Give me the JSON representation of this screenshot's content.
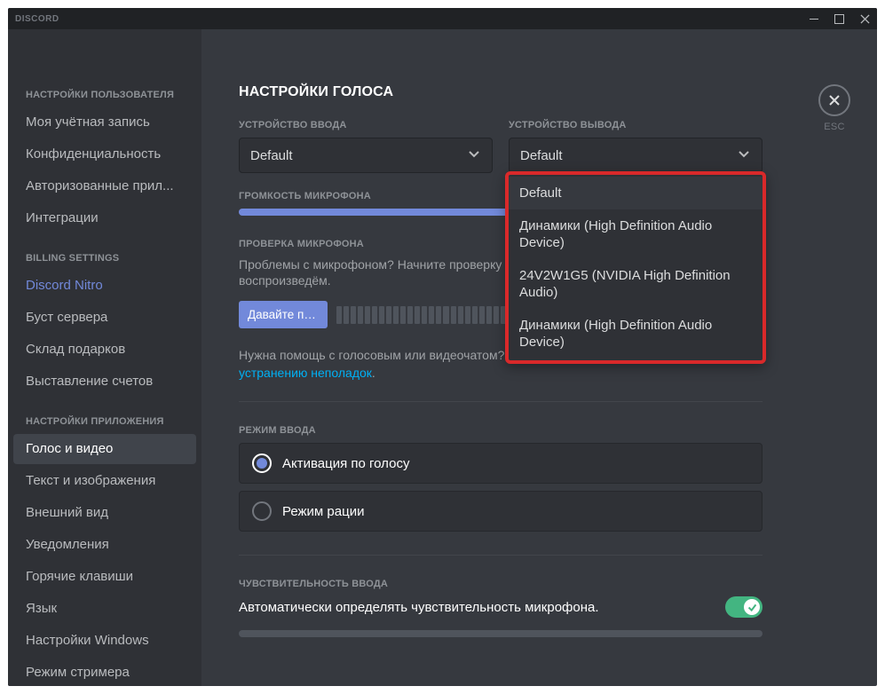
{
  "titlebar": {
    "title": "DISCORD"
  },
  "close": {
    "label": "ESC"
  },
  "sidebar": {
    "section1_header": "НАСТРОЙКИ ПОЛЬЗОВАТЕЛЯ",
    "section1": [
      "Моя учётная запись",
      "Конфиденциальность",
      "Авторизованные прил...",
      "Интеграции"
    ],
    "section2_header": "BILLING SETTINGS",
    "section2": [
      "Discord Nitro",
      "Буст сервера",
      "Склад подарков",
      "Выставление счетов"
    ],
    "section3_header": "НАСТРОЙКИ ПРИЛОЖЕНИЯ",
    "section3": [
      "Голос и видео",
      "Текст и изображения",
      "Внешний вид",
      "Уведомления",
      "Горячие клавиши",
      "Язык",
      "Настройки Windows",
      "Режим стримера"
    ]
  },
  "page": {
    "title": "НАСТРОЙКИ ГОЛОСА",
    "input_device_label": "УСТРОЙСТВО ВВОДА",
    "output_device_label": "УСТРОЙСТВО ВЫВОДА",
    "input_device_value": "Default",
    "output_device_value": "Default",
    "output_options": [
      "Default",
      "Динамики (High Definition Audio Device)",
      "24V2W1G5 (NVIDIA High Definition Audio)",
      "Динамики (High Definition Audio Device)"
    ],
    "mic_volume_label": "ГРОМКОСТЬ МИКРОФОНА",
    "mic_volume_percent": 98,
    "mic_test_label": "ПРОВЕРКА МИКРОФОНА",
    "mic_test_desc": "Проблемы с микрофоном? Начните проверку и скажите что-нибудь забавное — мы воспроизведём.",
    "mic_test_btn": "Давайте пр...",
    "help_pre": "Нужна помощь с голосовым или видеочатом? Ознакомьтесь с нашим ",
    "help_link": "руководством по устранению неполадок",
    "help_post": ".",
    "input_mode_label": "РЕЖИМ ВВОДА",
    "input_mode_options": [
      {
        "label": "Активация по голосу",
        "checked": true
      },
      {
        "label": "Режим рации",
        "checked": false
      }
    ],
    "sensitivity_label": "ЧУВСТВИТЕЛЬНОСТЬ ВВОДА",
    "sensitivity_auto_label": "Автоматически определять чувствительность микрофона.",
    "sensitivity_auto_on": true
  }
}
